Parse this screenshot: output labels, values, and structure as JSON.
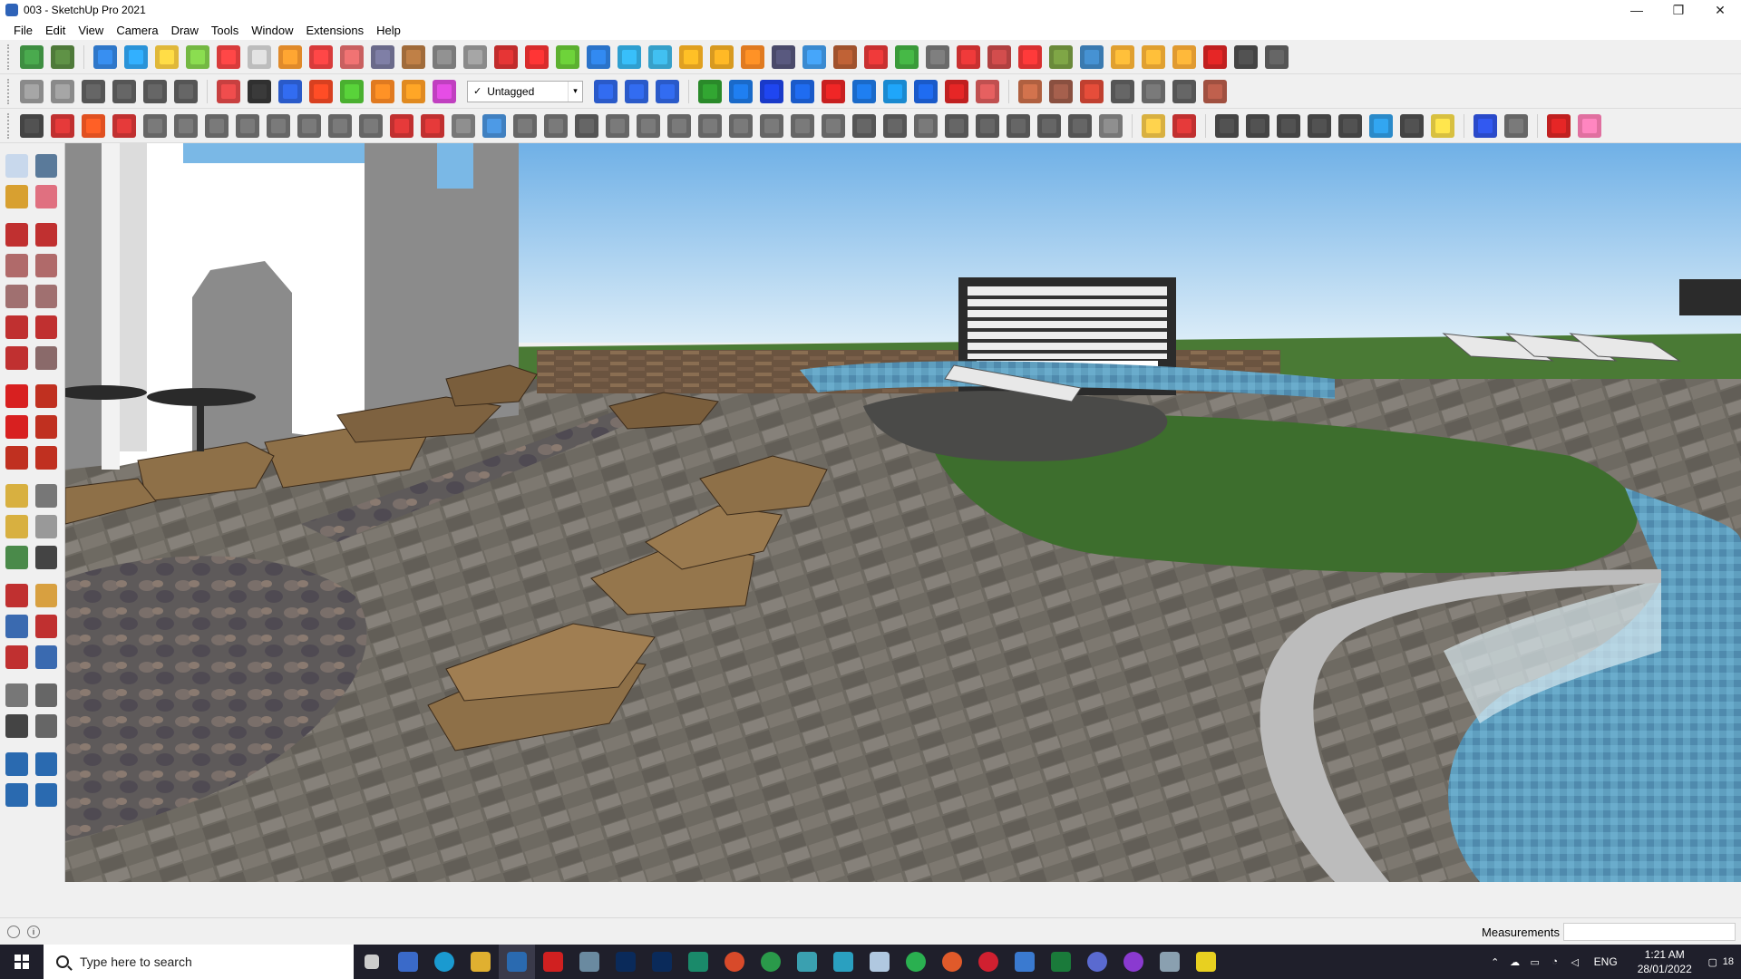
{
  "window": {
    "title": "003 - SketchUp Pro 2021",
    "minimize": "—",
    "restore": "❐",
    "close": "✕"
  },
  "menu": [
    "File",
    "Edit",
    "View",
    "Camera",
    "Draw",
    "Tools",
    "Window",
    "Extensions",
    "Help"
  ],
  "toolbar": {
    "tag_selected": "Untagged",
    "tag_check": "✓",
    "tag_chevron": "▾"
  },
  "colors": {
    "sky_top": "#7cb8e8",
    "sky_bottom": "#d7ecf8",
    "paving": "#6f6a61",
    "grass": "#3f6f2e",
    "pool": "#7db7cf",
    "stone": "#8a6a43",
    "wall": "#ffffff"
  },
  "statusbar": {
    "measurements_label": "Measurements",
    "measurements_value": ""
  },
  "taskbar": {
    "search_placeholder": "Type here to search",
    "language": "ENG",
    "time": "1:21 AM",
    "date": "28/01/2022",
    "notifications": "18"
  }
}
